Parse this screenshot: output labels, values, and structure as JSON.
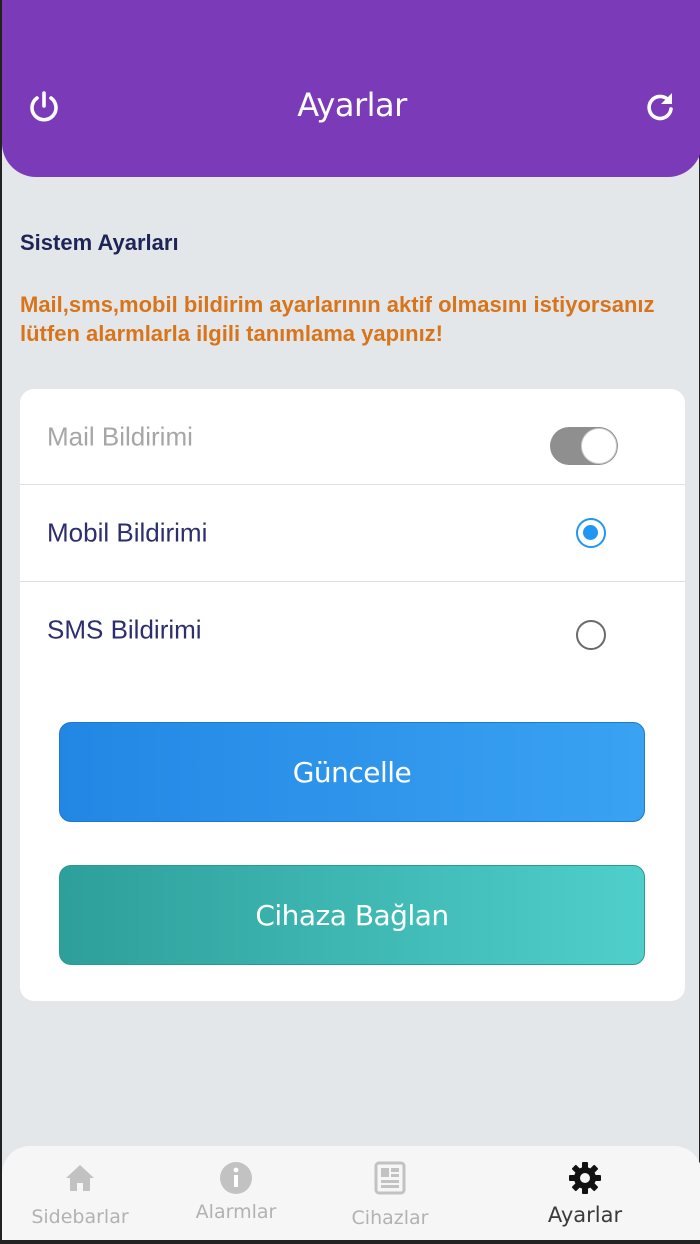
{
  "header": {
    "title": "Ayarlar",
    "power_icon": "power-icon",
    "refresh_icon": "refresh-icon",
    "bg_color": "#7b3ab7"
  },
  "section": {
    "title": "Sistem Ayarları",
    "warning": "Mail,sms,mobil bildirim ayarlarının aktif olmasını istiyorsanız lütfen alarmlarla ilgili tanımlama yapınız!"
  },
  "settings": {
    "mail": {
      "label": "Mail Bildirimi",
      "control": "toggle",
      "enabled": false,
      "on": true
    },
    "mobile": {
      "label": "Mobil Bildirimi",
      "control": "radio",
      "checked": true
    },
    "sms": {
      "label": "SMS Bildirimi",
      "control": "radio",
      "checked": false
    }
  },
  "buttons": {
    "update_label": "Güncelle",
    "connect_label": "Cihaza Bağlan"
  },
  "bottom_nav": {
    "items": [
      {
        "label": "Sidebarlar",
        "icon": "home-icon",
        "active": false
      },
      {
        "label": "Alarmlar",
        "icon": "info-icon",
        "active": false
      },
      {
        "label": "Cihazlar",
        "icon": "device-icon",
        "active": false
      },
      {
        "label": "Ayarlar",
        "icon": "gear-icon",
        "active": true
      }
    ]
  },
  "colors": {
    "accent": "#2196f3",
    "warning": "#d8741a",
    "title_text": "#1d2457"
  }
}
